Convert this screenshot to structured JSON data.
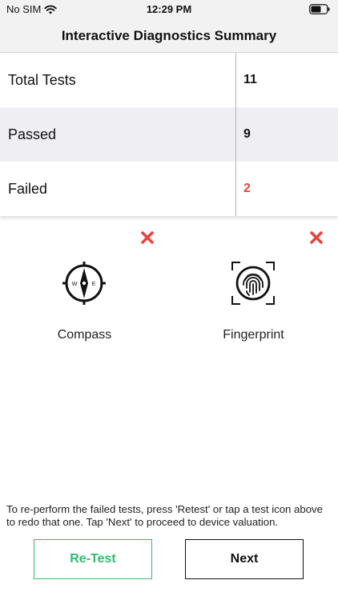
{
  "status_bar": {
    "carrier": "No SIM",
    "time": "12:29 PM"
  },
  "header": {
    "title": "Interactive Diagnostics Summary"
  },
  "summary": {
    "rows": [
      {
        "label": "Total Tests",
        "value": "11"
      },
      {
        "label": "Passed",
        "value": "9"
      },
      {
        "label": "Failed",
        "value": "2"
      }
    ]
  },
  "failed_tests": [
    {
      "label": "Compass",
      "icon": "compass-icon",
      "status": "failed"
    },
    {
      "label": "Fingerprint",
      "icon": "fingerprint-icon",
      "status": "failed"
    }
  ],
  "instructions": "To re-perform the failed tests, press 'Retest' or tap a test icon above to redo that one. Tap 'Next' to proceed to device valuation.",
  "buttons": {
    "retest_label": "Re-Test",
    "next_label": "Next"
  },
  "colors": {
    "failed": "#e8453c",
    "retest": "#2fbd6c",
    "header_bg": "#f2f2f2",
    "row_alt_bg": "#efeff3"
  }
}
